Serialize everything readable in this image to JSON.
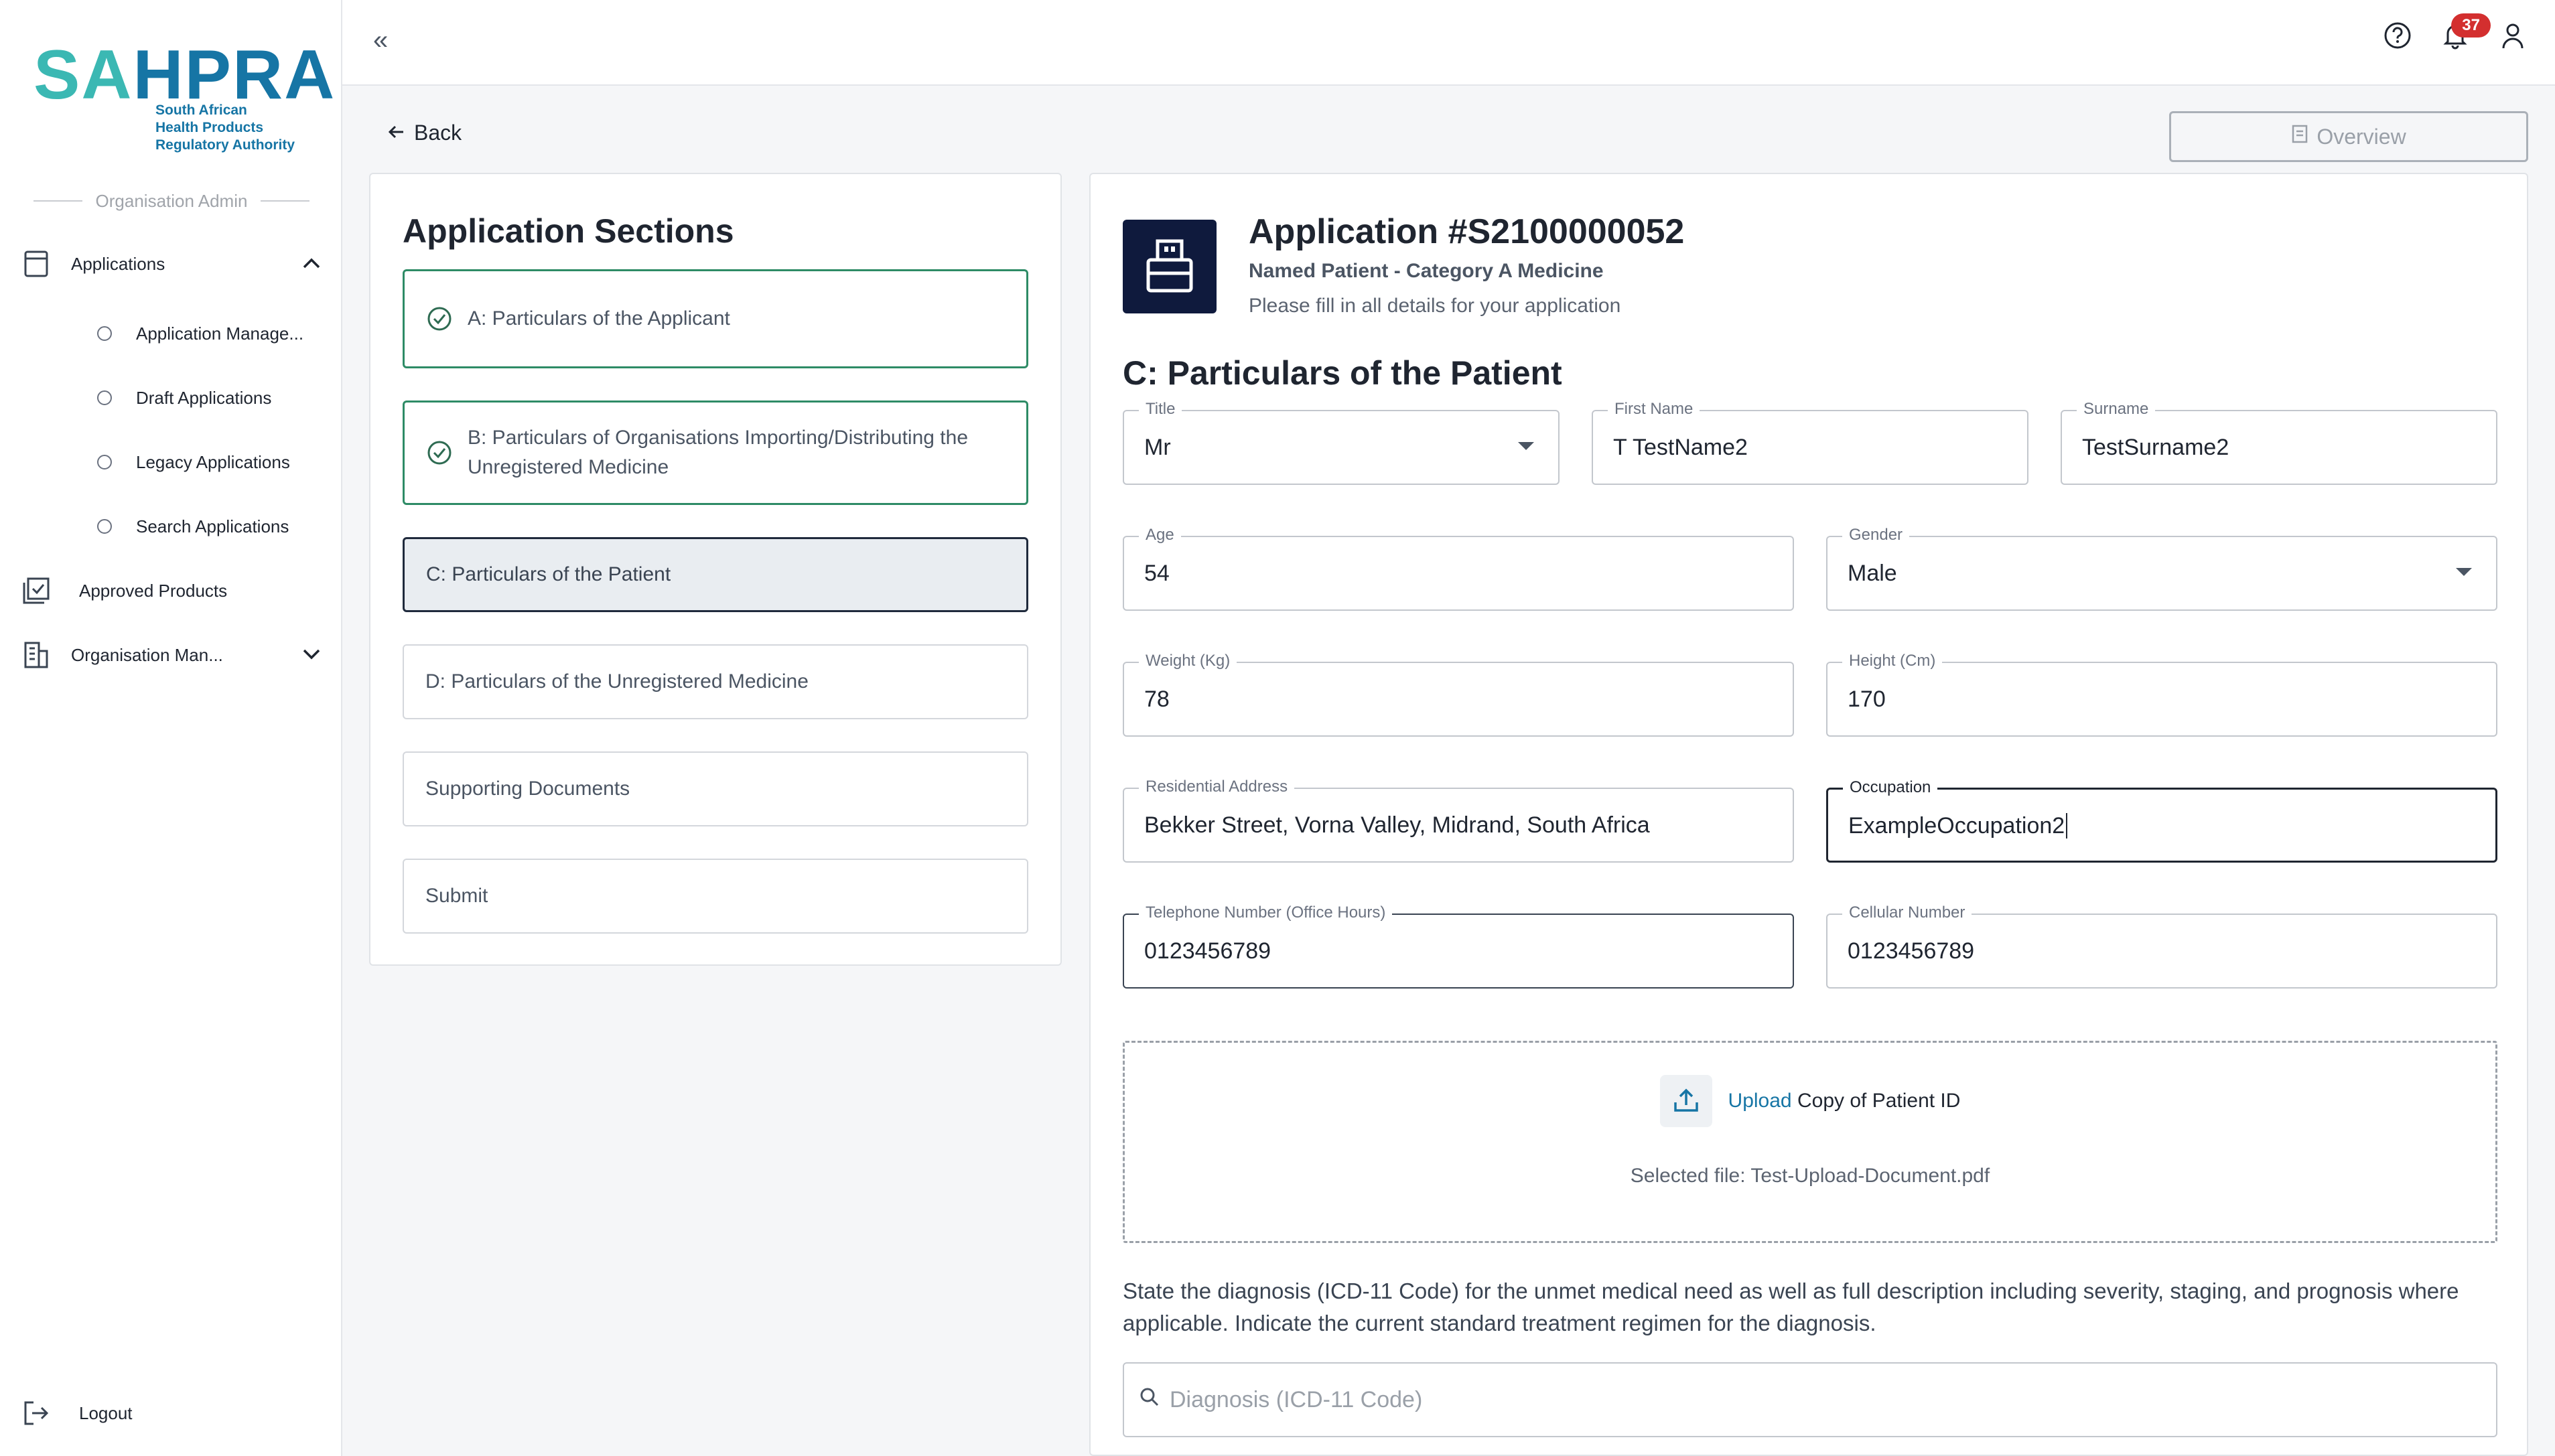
{
  "brand": {
    "abbr_sa": "SA",
    "abbr_hpra": "HPRA",
    "line1": "South African",
    "line2": "Health Products",
    "line3": "Regulatory Authority"
  },
  "sidebar": {
    "role": "Organisation Admin",
    "applications": "Applications",
    "sub_items": [
      {
        "label": "Application Manage..."
      },
      {
        "label": "Draft Applications"
      },
      {
        "label": "Legacy Applications"
      },
      {
        "label": "Search Applications"
      }
    ],
    "approved_products": "Approved Products",
    "organisation": "Organisation Man...",
    "logout": "Logout"
  },
  "topbar": {
    "collapse_glyph": "«",
    "notification_count": "37"
  },
  "nav": {
    "back": "Back",
    "overview": "Overview"
  },
  "sections": {
    "title": "Application Sections",
    "items": [
      {
        "label": "A: Particulars of the Applicant",
        "state": "done"
      },
      {
        "label": "B: Particulars of Organisations Importing/Distributing the Unregistered Medicine",
        "state": "done"
      },
      {
        "label": "C: Particulars of the Patient",
        "state": "active"
      },
      {
        "label": "D: Particulars of the Unregistered Medicine",
        "state": "pending"
      },
      {
        "label": "Supporting Documents",
        "state": "pending"
      },
      {
        "label": "Submit",
        "state": "pending"
      }
    ]
  },
  "application": {
    "title": "Application #S2100000052",
    "subtitle": "Named Patient - Category A Medicine",
    "description": "Please fill in all details for your application",
    "section_heading": "C: Particulars of the Patient"
  },
  "form": {
    "title": {
      "label": "Title",
      "value": "Mr"
    },
    "first_name": {
      "label": "First Name",
      "value": "T TestName2"
    },
    "surname": {
      "label": "Surname",
      "value": "TestSurname2"
    },
    "age": {
      "label": "Age",
      "value": "54"
    },
    "gender": {
      "label": "Gender",
      "value": "Male"
    },
    "weight": {
      "label": "Weight (Kg)",
      "value": "78"
    },
    "height": {
      "label": "Height (Cm)",
      "value": "170"
    },
    "address": {
      "label": "Residential Address",
      "value": "Bekker Street, Vorna Valley, Midrand, South Africa"
    },
    "occupation": {
      "label": "Occupation",
      "value": "ExampleOccupation2"
    },
    "telephone": {
      "label": "Telephone Number (Office Hours)",
      "value": "0123456789"
    },
    "cellular": {
      "label": "Cellular Number",
      "value": "0123456789"
    }
  },
  "upload": {
    "link": "Upload",
    "text": "Copy of Patient ID",
    "selected": "Selected file: Test-Upload-Document.pdf"
  },
  "diagnosis": {
    "instructions": "State the diagnosis (ICD-11 Code) for the unmet medical need as well as full description including severity, staging, and prognosis where applicable. Indicate the current standard treatment regimen for the diagnosis.",
    "placeholder": "Diagnosis (ICD-11 Code)"
  },
  "colors": {
    "brand_teal": "#3bb8b3",
    "brand_blue": "#1675a5",
    "done_green": "#2e8b66",
    "badge_red": "#d32f2f",
    "icon_navy": "#0f1a3d"
  }
}
